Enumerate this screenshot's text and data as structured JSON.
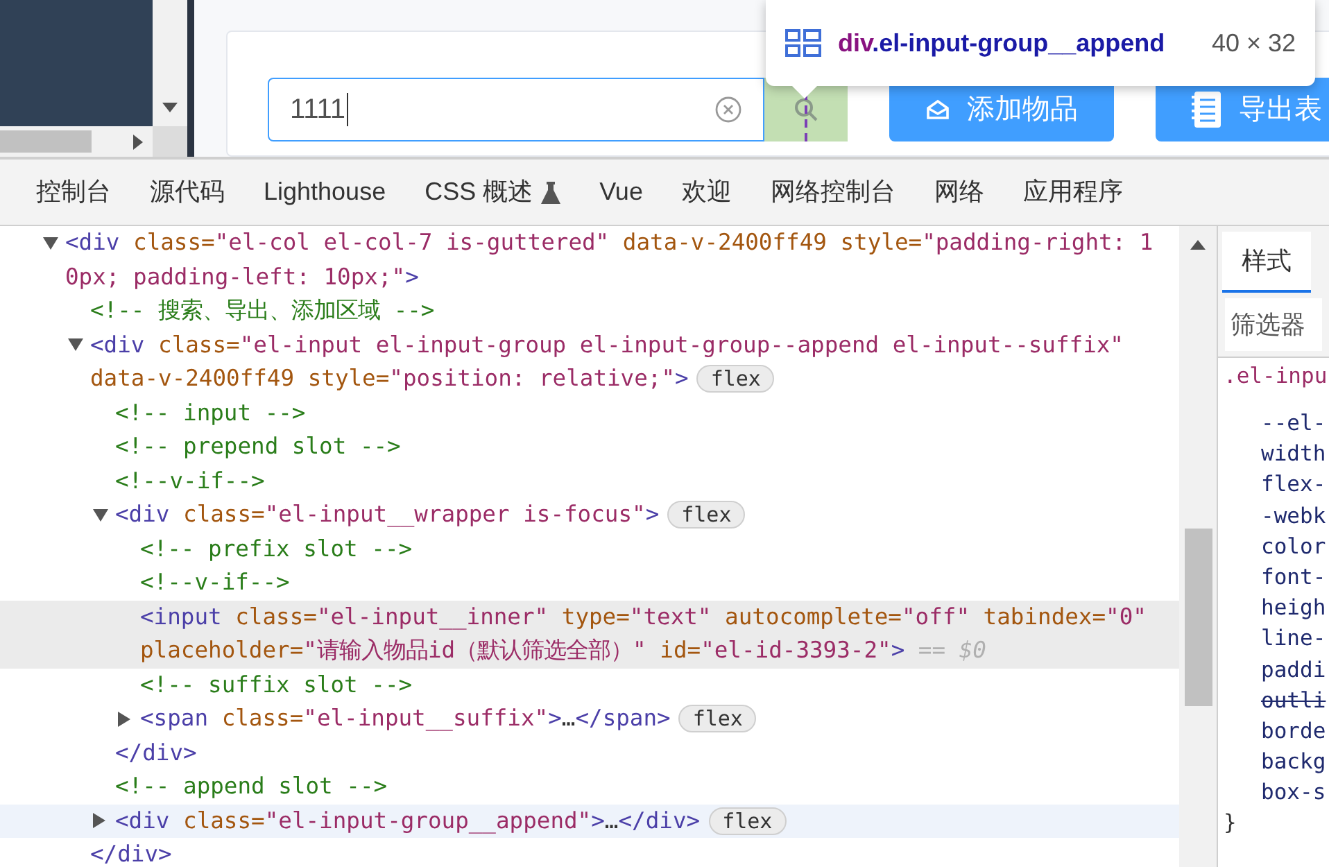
{
  "page": {
    "search_field": {
      "value": "1111"
    },
    "buttons": [
      {
        "label": "添加物品",
        "kind": "add"
      },
      {
        "label": "导出表",
        "kind": "export"
      }
    ]
  },
  "inspect_tooltip": {
    "tag": "div",
    "class_name": ".el-input-group__append",
    "size": "40 × 32"
  },
  "devtools": {
    "tabs": [
      {
        "label": "控制台",
        "selected": false,
        "kind": "plain"
      },
      {
        "label": "源代码",
        "selected": false,
        "kind": "plain"
      },
      {
        "label": "Lighthouse",
        "selected": false,
        "kind": "plain"
      },
      {
        "label": "CSS 概述",
        "selected": false,
        "kind": "experimental"
      },
      {
        "label": "Vue",
        "selected": false,
        "kind": "plain"
      },
      {
        "label": "欢迎",
        "selected": false,
        "kind": "plain"
      },
      {
        "label": "网络控制台",
        "selected": false,
        "kind": "plain"
      },
      {
        "label": "网络",
        "selected": false,
        "kind": "plain"
      },
      {
        "label": "应用程序",
        "selected": false,
        "kind": "plain"
      }
    ],
    "elements": [
      {
        "kind": "element",
        "expanded": true,
        "selected": false,
        "hovered": false,
        "lines": [
          [
            {
              "kind": "tag",
              "text": "<div"
            },
            {
              "kind": "attr",
              "text": " class="
            },
            {
              "kind": "val",
              "text": "\"el-col el-col-7 is-guttered\""
            },
            {
              "kind": "attr",
              "text": " data-v-2400ff49 style="
            },
            {
              "kind": "val",
              "text": "\"padding-right: 1"
            }
          ],
          [
            {
              "kind": "val",
              "text": "0px; padding-left: 10px;\""
            },
            {
              "kind": "tag",
              "text": ">"
            }
          ]
        ],
        "children": [
          {
            "kind": "comment",
            "selected": false,
            "hovered": false,
            "lines": [
              [
                {
                  "kind": "comment",
                  "text": "<!-- 搜索、导出、添加区域 -->"
                }
              ]
            ]
          },
          {
            "kind": "element",
            "expanded": true,
            "selected": false,
            "hovered": false,
            "badge": "flex",
            "lines": [
              [
                {
                  "kind": "tag",
                  "text": "<div"
                },
                {
                  "kind": "attr",
                  "text": " class="
                },
                {
                  "kind": "val",
                  "text": "\"el-input el-input-group el-input-group--append el-input--suffix\""
                }
              ],
              [
                {
                  "kind": "attr",
                  "text": "data-v-2400ff49 style="
                },
                {
                  "kind": "val",
                  "text": "\"position: relative;\""
                },
                {
                  "kind": "tag",
                  "text": ">"
                }
              ]
            ],
            "children": [
              {
                "kind": "comment",
                "selected": false,
                "hovered": false,
                "lines": [
                  [
                    {
                      "kind": "comment",
                      "text": "<!-- input -->"
                    }
                  ]
                ]
              },
              {
                "kind": "comment",
                "selected": false,
                "hovered": false,
                "lines": [
                  [
                    {
                      "kind": "comment",
                      "text": "<!-- prepend slot -->"
                    }
                  ]
                ]
              },
              {
                "kind": "comment",
                "selected": false,
                "hovered": false,
                "lines": [
                  [
                    {
                      "kind": "comment",
                      "text": "<!--v-if-->"
                    }
                  ]
                ]
              },
              {
                "kind": "element",
                "expanded": true,
                "selected": false,
                "hovered": false,
                "badge": "flex",
                "lines": [
                  [
                    {
                      "kind": "tag",
                      "text": "<div"
                    },
                    {
                      "kind": "attr",
                      "text": " class="
                    },
                    {
                      "kind": "val",
                      "text": "\"el-input__wrapper is-focus\""
                    },
                    {
                      "kind": "tag",
                      "text": ">"
                    }
                  ]
                ],
                "children": [
                  {
                    "kind": "comment",
                    "selected": false,
                    "hovered": false,
                    "lines": [
                      [
                        {
                          "kind": "comment",
                          "text": "<!-- prefix slot -->"
                        }
                      ]
                    ]
                  },
                  {
                    "kind": "comment",
                    "selected": false,
                    "hovered": false,
                    "lines": [
                      [
                        {
                          "kind": "comment",
                          "text": "<!--v-if-->"
                        }
                      ]
                    ]
                  },
                  {
                    "kind": "leaf",
                    "selected": true,
                    "hovered": false,
                    "lines": [
                      [
                        {
                          "kind": "tag",
                          "text": "<input"
                        },
                        {
                          "kind": "attr",
                          "text": " class="
                        },
                        {
                          "kind": "val",
                          "text": "\"el-input__inner\""
                        },
                        {
                          "kind": "attr",
                          "text": " type="
                        },
                        {
                          "kind": "val",
                          "text": "\"text\""
                        },
                        {
                          "kind": "attr",
                          "text": " autocomplete="
                        },
                        {
                          "kind": "val",
                          "text": "\"off\""
                        },
                        {
                          "kind": "attr",
                          "text": " tabindex="
                        },
                        {
                          "kind": "val",
                          "text": "\"0\""
                        }
                      ],
                      [
                        {
                          "kind": "attr",
                          "text": "placeholder="
                        },
                        {
                          "kind": "val",
                          "text": "\"请输入物品id（默认筛选全部）\""
                        },
                        {
                          "kind": "attr",
                          "text": " id="
                        },
                        {
                          "kind": "val",
                          "text": "\"el-id-3393-2\""
                        },
                        {
                          "kind": "tag",
                          "text": ">"
                        },
                        {
                          "kind": "hint",
                          "text": " == $0"
                        }
                      ]
                    ]
                  },
                  {
                    "kind": "comment",
                    "selected": false,
                    "hovered": false,
                    "lines": [
                      [
                        {
                          "kind": "comment",
                          "text": "<!-- suffix slot -->"
                        }
                      ]
                    ]
                  },
                  {
                    "kind": "element",
                    "expanded": false,
                    "selected": false,
                    "hovered": false,
                    "badge": "flex",
                    "lines": [
                      [
                        {
                          "kind": "tag",
                          "text": "<span"
                        },
                        {
                          "kind": "attr",
                          "text": " class="
                        },
                        {
                          "kind": "val",
                          "text": "\"el-input__suffix\""
                        },
                        {
                          "kind": "tag",
                          "text": ">"
                        },
                        {
                          "kind": "text",
                          "text": "…"
                        },
                        {
                          "kind": "tag",
                          "text": "</span>"
                        }
                      ]
                    ]
                  }
                ],
                "closing": [
                  {
                    "kind": "tag",
                    "text": "</div>"
                  }
                ]
              },
              {
                "kind": "comment",
                "selected": false,
                "hovered": false,
                "lines": [
                  [
                    {
                      "kind": "comment",
                      "text": "<!-- append slot -->"
                    }
                  ]
                ]
              },
              {
                "kind": "element",
                "expanded": false,
                "selected": false,
                "hovered": true,
                "badge": "flex",
                "lines": [
                  [
                    {
                      "kind": "tag",
                      "text": "<div"
                    },
                    {
                      "kind": "attr",
                      "text": " class="
                    },
                    {
                      "kind": "val",
                      "text": "\"el-input-group__append\""
                    },
                    {
                      "kind": "tag",
                      "text": ">"
                    },
                    {
                      "kind": "text",
                      "text": "…"
                    },
                    {
                      "kind": "tag",
                      "text": "</div>"
                    }
                  ]
                ]
              }
            ],
            "closing": [
              {
                "kind": "tag",
                "text": "</div>"
              }
            ]
          }
        ]
      }
    ],
    "styles": {
      "tabs": [
        {
          "label": "样式",
          "selected": true
        }
      ],
      "filter": {
        "placeholder": "筛选器"
      },
      "selector": ".el-inpu",
      "properties": [
        {
          "name": "--el-",
          "overridden": false
        },
        {
          "name": "width",
          "overridden": false
        },
        {
          "name": "flex-",
          "overridden": false
        },
        {
          "name": "-webk",
          "overridden": false
        },
        {
          "name": "color",
          "overridden": false
        },
        {
          "name": "font-",
          "overridden": false
        },
        {
          "name": "heigh",
          "overridden": false
        },
        {
          "name": "line-",
          "overridden": false
        },
        {
          "name": "paddi",
          "overridden": false
        },
        {
          "name": "outli",
          "overridden": true
        },
        {
          "name": "borde",
          "overridden": false
        },
        {
          "name": "backg",
          "overridden": false
        },
        {
          "name": "box-s",
          "overridden": false
        }
      ],
      "rule_end": "}"
    }
  }
}
